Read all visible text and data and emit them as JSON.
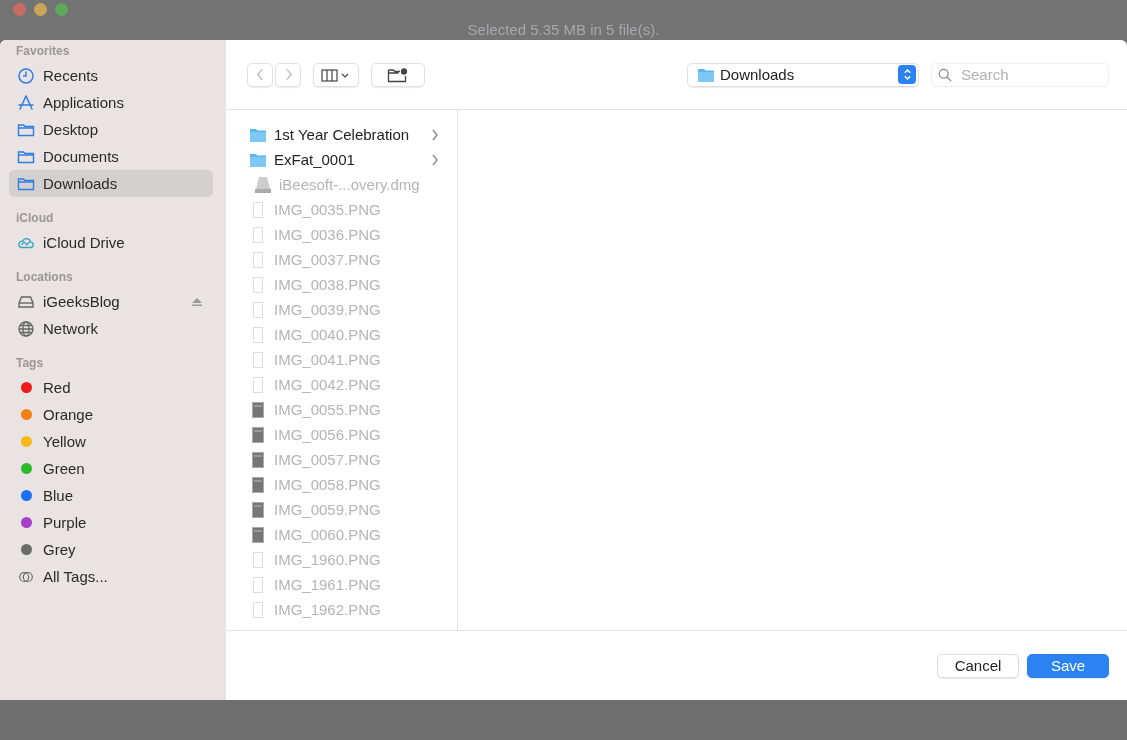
{
  "window": {
    "title": "Selected 5.35 MB in 5 file(s)."
  },
  "sidebar": {
    "sections": [
      {
        "title": "Favorites",
        "items": [
          {
            "label": "Recents",
            "kind": "clock",
            "selected": false
          },
          {
            "label": "Applications",
            "kind": "apps",
            "selected": false
          },
          {
            "label": "Desktop",
            "kind": "folder",
            "selected": false
          },
          {
            "label": "Documents",
            "kind": "folder",
            "selected": false
          },
          {
            "label": "Downloads",
            "kind": "folder",
            "selected": true
          }
        ]
      },
      {
        "title": "iCloud",
        "items": [
          {
            "label": "iCloud Drive",
            "kind": "cloud",
            "selected": false
          }
        ]
      },
      {
        "title": "Locations",
        "items": [
          {
            "label": "iGeeksBlog",
            "kind": "disk",
            "selected": false,
            "ejectable": true
          },
          {
            "label": "Network",
            "kind": "globe",
            "selected": false
          }
        ]
      },
      {
        "title": "Tags",
        "items": [
          {
            "label": "Red",
            "kind": "tag",
            "color": "#ee1c1c",
            "selected": false
          },
          {
            "label": "Orange",
            "kind": "tag",
            "color": "#f57f17",
            "selected": false
          },
          {
            "label": "Yellow",
            "kind": "tag",
            "color": "#f6b915",
            "selected": false
          },
          {
            "label": "Green",
            "kind": "tag",
            "color": "#2dbb2a",
            "selected": false
          },
          {
            "label": "Blue",
            "kind": "tag",
            "color": "#1a6ff5",
            "selected": false
          },
          {
            "label": "Purple",
            "kind": "tag",
            "color": "#a63fcc",
            "selected": false
          },
          {
            "label": "Grey",
            "kind": "tag",
            "color": "#6b6b6b",
            "selected": false
          },
          {
            "label": "All Tags...",
            "kind": "alltags",
            "selected": false
          }
        ]
      }
    ]
  },
  "toolbar": {
    "location": "Downloads",
    "search": {
      "placeholder": "Search"
    }
  },
  "files": [
    {
      "name": "1st Year Celebration",
      "kind": "folder",
      "disabled": false
    },
    {
      "name": "ExFat_0001",
      "kind": "folder",
      "disabled": false
    },
    {
      "name": "iBeesoft-...overy.dmg",
      "kind": "dmg",
      "disabled": true
    },
    {
      "name": "IMG_0035.PNG",
      "kind": "blank",
      "disabled": true
    },
    {
      "name": "IMG_0036.PNG",
      "kind": "blank",
      "disabled": true
    },
    {
      "name": "IMG_0037.PNG",
      "kind": "blank",
      "disabled": true
    },
    {
      "name": "IMG_0038.PNG",
      "kind": "blank",
      "disabled": true
    },
    {
      "name": "IMG_0039.PNG",
      "kind": "blank",
      "disabled": true
    },
    {
      "name": "IMG_0040.PNG",
      "kind": "blank",
      "disabled": true
    },
    {
      "name": "IMG_0041.PNG",
      "kind": "blank",
      "disabled": true
    },
    {
      "name": "IMG_0042.PNG",
      "kind": "blank",
      "disabled": true
    },
    {
      "name": "IMG_0055.PNG",
      "kind": "image",
      "disabled": true
    },
    {
      "name": "IMG_0056.PNG",
      "kind": "image",
      "disabled": true
    },
    {
      "name": "IMG_0057.PNG",
      "kind": "image",
      "disabled": true
    },
    {
      "name": "IMG_0058.PNG",
      "kind": "image",
      "disabled": true
    },
    {
      "name": "IMG_0059.PNG",
      "kind": "image",
      "disabled": true
    },
    {
      "name": "IMG_0060.PNG",
      "kind": "image",
      "disabled": true
    },
    {
      "name": "IMG_1960.PNG",
      "kind": "blank",
      "disabled": true
    },
    {
      "name": "IMG_1961.PNG",
      "kind": "blank",
      "disabled": true
    },
    {
      "name": "IMG_1962.PNG",
      "kind": "blank",
      "disabled": true
    }
  ],
  "buttons": [
    {
      "label": "Cancel",
      "kind": "secondary"
    },
    {
      "label": "Save",
      "kind": "primary"
    }
  ]
}
